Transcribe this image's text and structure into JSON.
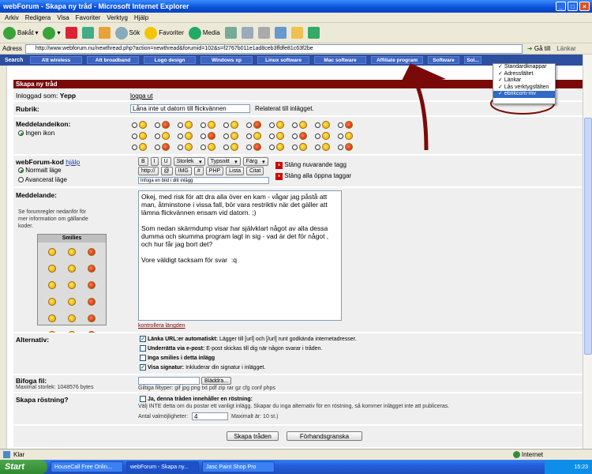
{
  "window": {
    "title": "webForum - Skapa ny tråd - Microsoft Internet Explorer"
  },
  "menu": [
    "Arkiv",
    "Redigera",
    "Visa",
    "Favoriter",
    "Verktyg",
    "Hjälp"
  ],
  "toolbar": {
    "back": "Bakåt",
    "search": "Sök",
    "favorites": "Favoriter",
    "media": "Media"
  },
  "address": {
    "label": "Adress",
    "url": "http://www.webforum.nu/newthread.php?action=newthread&forumid=102&s=f2767b011e1ad8ceb3ffdfe81c63f2be",
    "go": "Gå till",
    "links": "Länkar"
  },
  "nav": {
    "search": "Search",
    "items": [
      "Att wireless",
      "Att broadband",
      "Logo design",
      "Windows xp",
      "Linux software",
      "Mac software",
      "Affiliate program",
      "Software",
      "Sol..."
    ]
  },
  "context_menu": {
    "items": [
      "Standardknappar",
      "Adressfältet",
      "Länkar",
      "Lås verktygsfälten",
      "ebrikcom-mv"
    ]
  },
  "form": {
    "header": "Skapa ny tråd",
    "logged_label": "Inloggad som:",
    "user": "Yepp",
    "logout": "logga ut",
    "subject_label": "Rubrik:",
    "subject_value": "Låna inte ut datorn till flickvännen",
    "subject_hint": "Relaterat till inlägget.",
    "icon_label": "Meddelandeikon:",
    "no_icon": "Ingen ikon",
    "code_label": "webForum-kod",
    "help": "hjälp",
    "normal_mode": "Normalt läge",
    "advanced_mode": "Avancerat läge",
    "code_buttons": [
      "B",
      "I",
      "U"
    ],
    "size_select": "Storlek",
    "font_select": "Typsnitt",
    "color_select": "Färg",
    "code_buttons2": [
      "http://",
      "@",
      "IMG",
      "#",
      "PHP",
      "Lista",
      "Citat"
    ],
    "close_tag": "Stäng nuvarande tagg",
    "close_all": "Stäng alla öppna taggar",
    "insert_image": "Infoga en bild i ditt inlägg",
    "message_label": "Meddelande:",
    "message_help": "Se forumregler nedanför för mer information om gällande koder.",
    "smilies_title": "Smilies",
    "message_text": "Okej, med risk för att dra alla över en kam - vågar jag påstå att man, åtminstone i vissa fall, bör vara restriktiv när det gäller att lämna flickvännen ensam vid datorn. ;)\n\nSom nedan skärmdump visar har självklart något av alla dessa dumma och skumma program lagt in sig - vad är det för något , och hur får jag bort det?\n\nVore väldigt tacksam för svar  :q",
    "check_length": "kontrollera längden",
    "options_label": "Alternativ:",
    "options": [
      {
        "bold": "Länka URL:er automatiskt:",
        "text": "Lägger till [url] och [/url] runt godkända internetadresser.",
        "checked": true
      },
      {
        "bold": "Underrätta via e-post:",
        "text": "E-post skickas till dig när någon svarar i tråden.",
        "checked": false
      },
      {
        "bold": "Inga smilies i detta inlägg",
        "text": "",
        "checked": false
      },
      {
        "bold": "Visa signatur:",
        "text": "Inkluderar din signatur i inlägget.",
        "checked": true
      }
    ],
    "attach_label": "Bifoga fil:",
    "max_size": "Maximal storlek: 1048576 bytes",
    "browse": "Bläddra...",
    "filetypes": "Giltiga filtyper: gif jpg png txt pdf zip rar gz cfg conf phps",
    "poll_label": "Skapa röstning?",
    "poll_check": "Ja, denna tråden innehåller en röstning:",
    "poll_help": "Välj INTE detta om du postar ett vanligt inlägg. Skapar du inga alternativ för en röstning, så kommer inlägget inte att publiceras.",
    "poll_options_label": "Antal valmöjligheter:",
    "poll_options_value": "4",
    "poll_max": "Maximalt är: 10 st.)",
    "submit": "Skapa tråden",
    "preview": "Förhandsgranska"
  },
  "status": {
    "left": "Klar",
    "zone": "Internet"
  },
  "taskbar": {
    "start": "Start",
    "items": [
      "HouseCall Free Onlin...",
      "webForum - Skapa ny...",
      "Jasc Paint Shop Pro"
    ],
    "clock": "15:23"
  }
}
